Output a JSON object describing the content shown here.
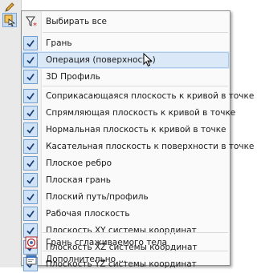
{
  "menu": {
    "select_all": "Выбирать все",
    "items": [
      {
        "label": "Грань",
        "checked": true
      },
      {
        "label": "Операция (поверхность)",
        "checked": true,
        "hover": true
      },
      {
        "label": "3D Профиль",
        "checked": true
      },
      {
        "label": "Соприкасающаяся плоскость к кривой в точке",
        "checked": true
      },
      {
        "label": "Спрямляющая плоскость к кривой в точке",
        "checked": true
      },
      {
        "label": "Нормальная плоскость к кривой в точке",
        "checked": true
      },
      {
        "label": "Касательная плоскость к поверхности в точке",
        "checked": true
      },
      {
        "label": "Плоское ребро",
        "checked": true
      },
      {
        "label": "Плоская грань",
        "checked": true
      },
      {
        "label": "Плоский путь/профиль",
        "checked": true
      },
      {
        "label": "Рабочая плоскость",
        "checked": true
      },
      {
        "label": "Плоскость XY системы координат",
        "checked": true
      },
      {
        "label": "Плоскость XZ системы координат",
        "checked": true
      },
      {
        "label": "Плоскость YZ системы координат",
        "checked": true
      }
    ],
    "smooth_face": "Грань сглаживаемого тела",
    "more": "Дополнительно ..."
  },
  "colors": {
    "accent": "#3a75c4",
    "hover_bg": "#dbe8f7",
    "check_bg": "#cfe2f6",
    "select_all_star": "#d61f1f"
  },
  "icons": {
    "select_all": "filter-star-icon",
    "check": "checkmark-icon",
    "smooth_face": "face-target-icon",
    "more": "dialog-window-icon"
  }
}
